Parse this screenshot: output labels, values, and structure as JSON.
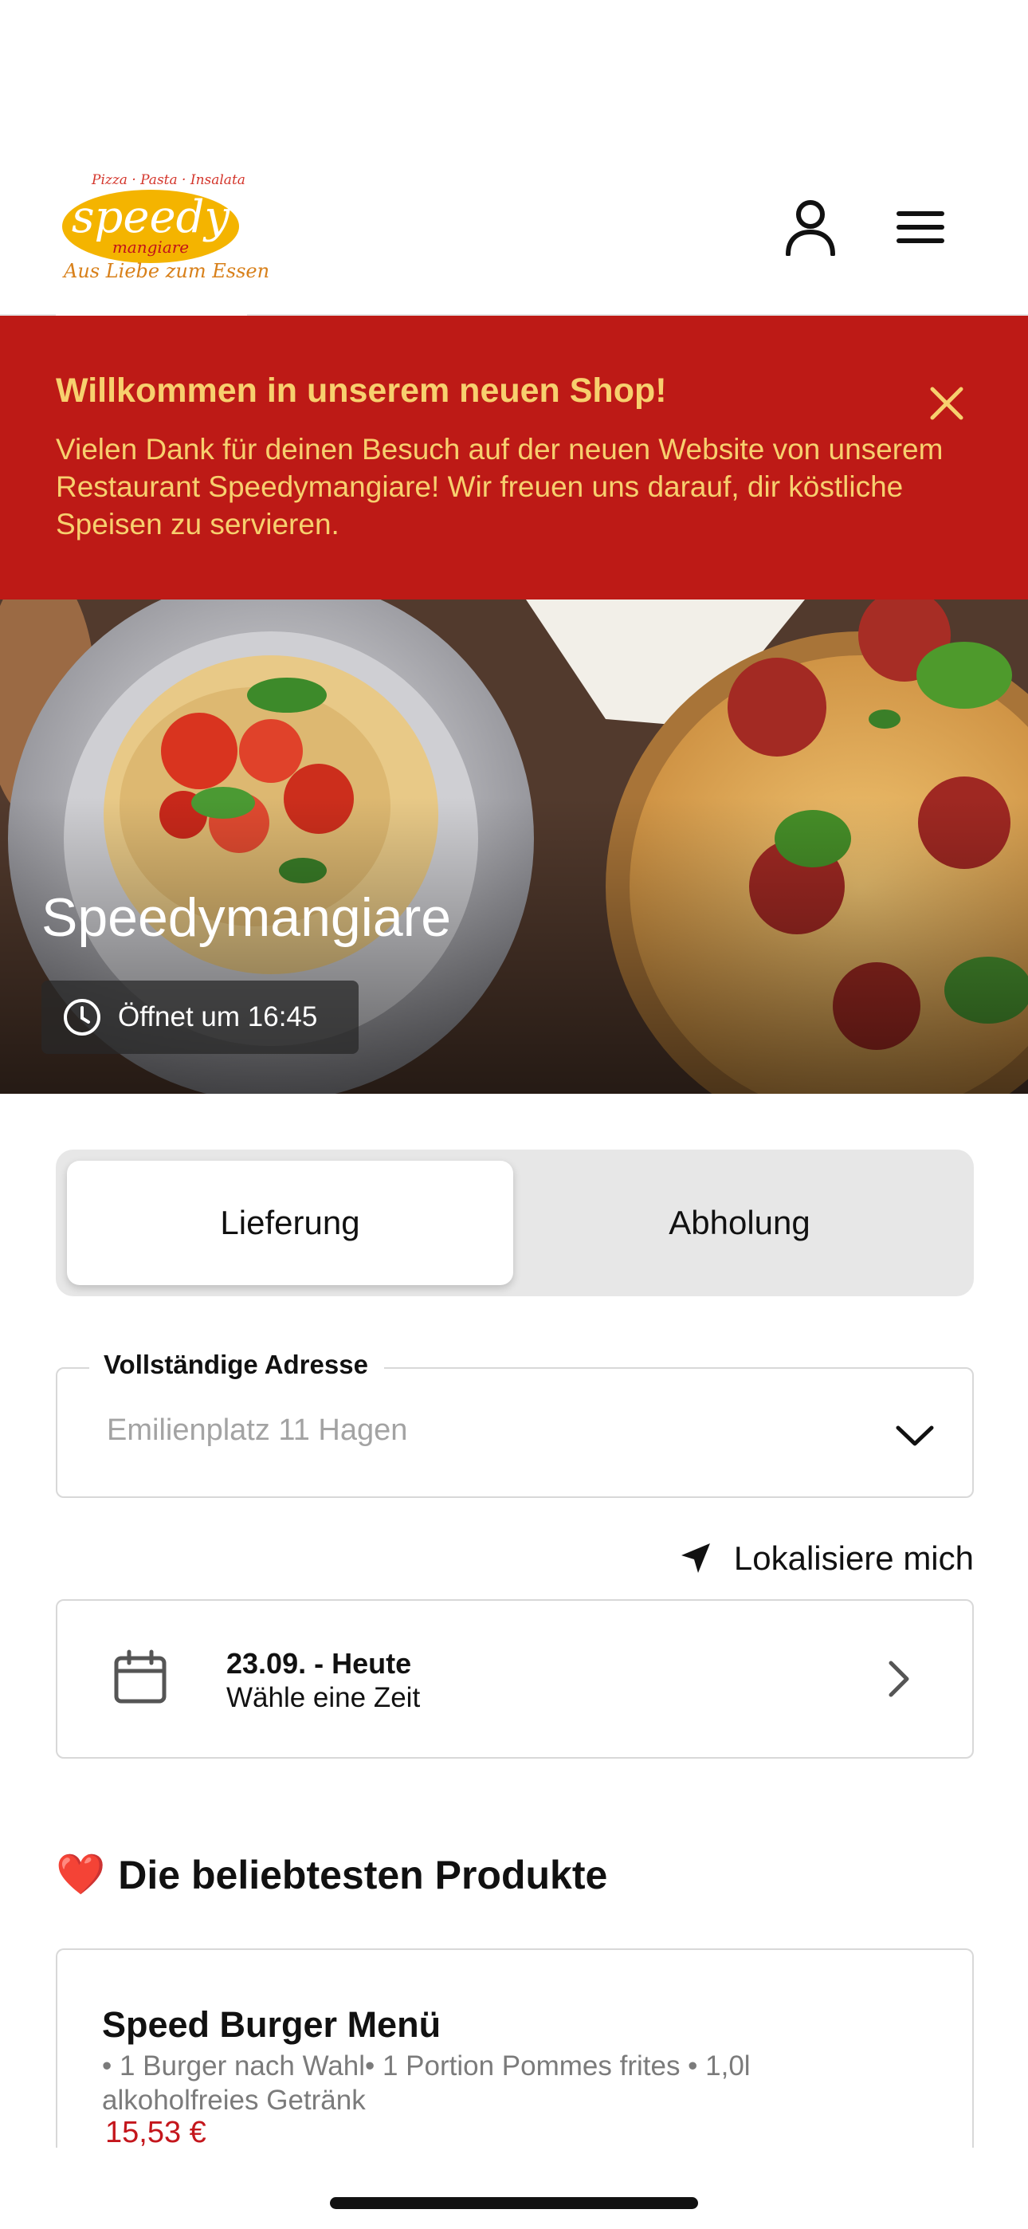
{
  "header": {
    "logo": {
      "tagline_top": "Pizza · Pasta · Insalata",
      "wordmark": "speedy",
      "sub": "mangiare",
      "tagline_bottom": "Aus Liebe zum Essen"
    },
    "icons": [
      "user-icon",
      "hamburger-menu-icon"
    ]
  },
  "banner": {
    "title": "Willkommen in unserem neuen Shop!",
    "text": "Vielen Dank für deinen Besuch auf der neuen Website von unserem Restaurant Speedymangiare! Wir freuen uns darauf, dir köstliche Speisen zu servieren.",
    "background": "#bd1a16",
    "text_color": "#f7d06e"
  },
  "hero": {
    "restaurant_name": "Speedymangiare",
    "opening": "Öffnet um 16:45"
  },
  "order_mode": {
    "options": [
      "Lieferung",
      "Abholung"
    ],
    "selected": "Lieferung"
  },
  "address": {
    "label": "Vollständige Adresse",
    "placeholder": "Emilienplatz 11 Hagen"
  },
  "locate": {
    "label": "Lokalisiere mich"
  },
  "date": {
    "day": "23.09. - Heute",
    "prompt": "Wähle eine Zeit"
  },
  "popular": {
    "title": "Die beliebtesten Produkte",
    "emoji": "❤️",
    "products": [
      {
        "name": "Speed Burger Menü",
        "description": "• 1 Burger nach Wahl• 1 Portion Pommes frites • 1,0l alkoholfreies Getränk",
        "price": "15,53 €"
      }
    ]
  },
  "colors": {
    "accent_red": "#bd1a16",
    "price_red": "#c4161c",
    "logo_yellow": "#f4b400"
  }
}
